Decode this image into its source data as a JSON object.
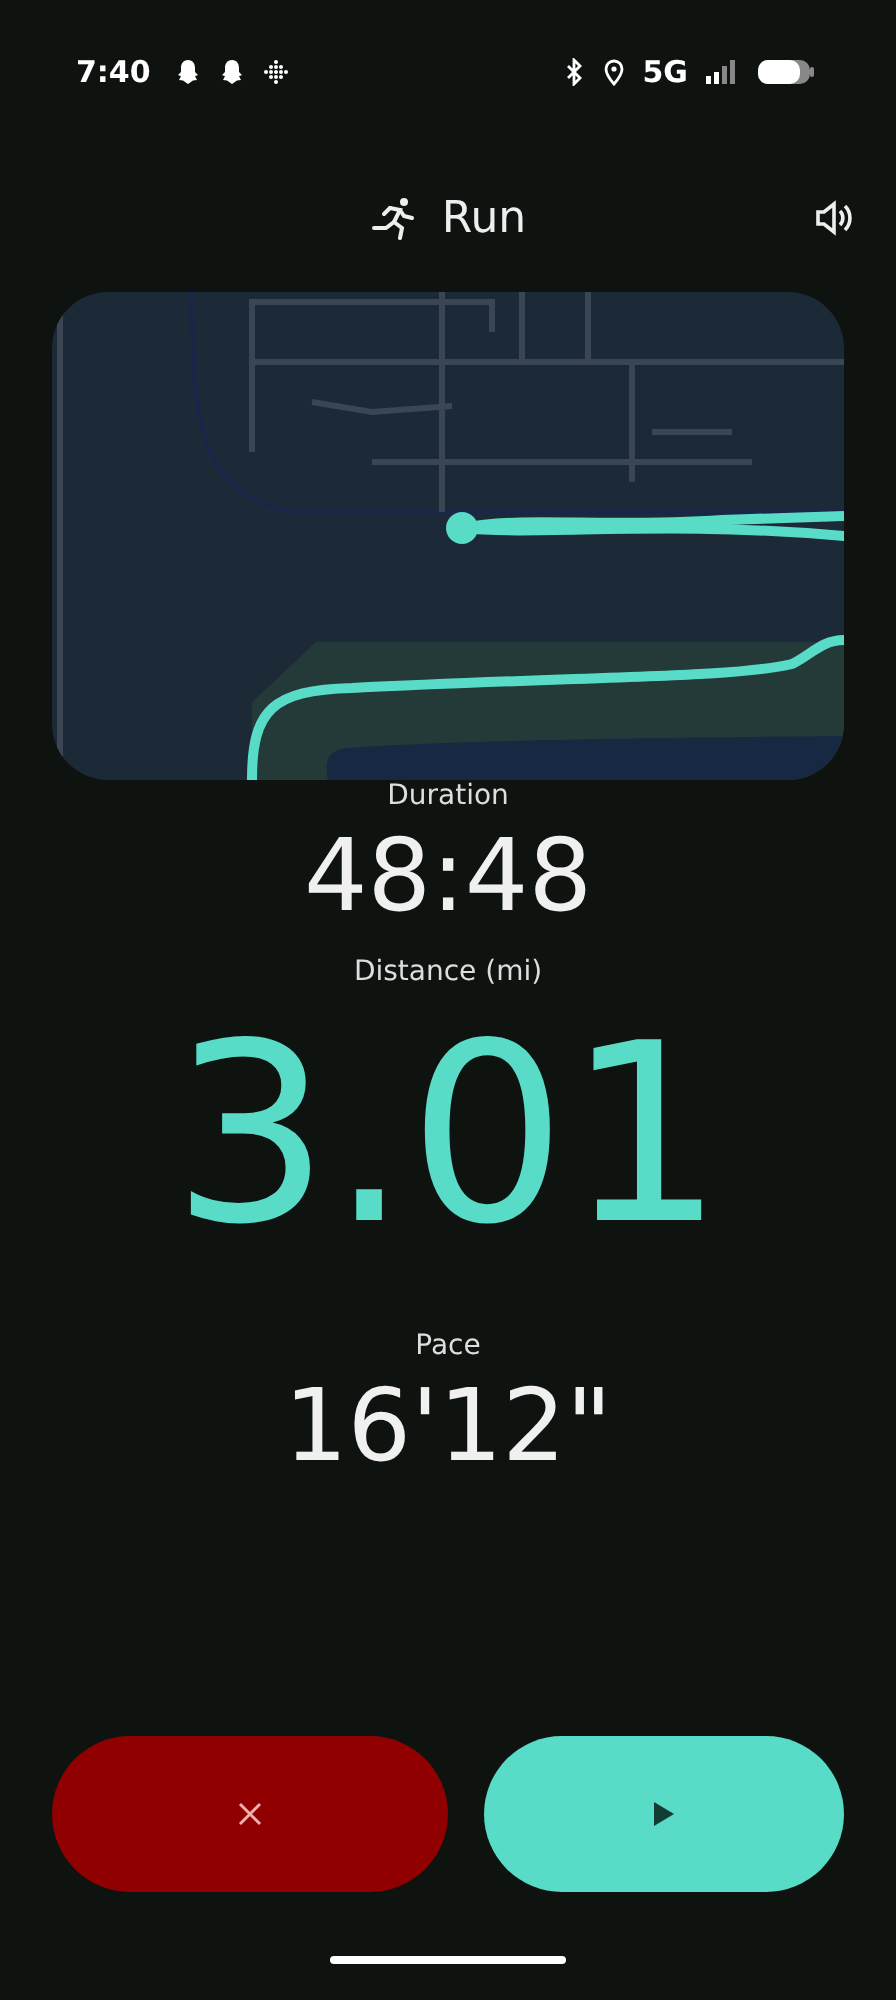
{
  "status_bar": {
    "time": "7:40",
    "network": "5G"
  },
  "header": {
    "title": "Run"
  },
  "stats": [
    {
      "label": "Duration",
      "value": "48:48",
      "kind": "normal"
    },
    {
      "label": "Distance (mi)",
      "value": "3.01",
      "kind": "highlight"
    },
    {
      "label": "Pace",
      "value": "16'12\"",
      "kind": "normal"
    }
  ],
  "buttons": [
    {
      "kind": "discard"
    },
    {
      "kind": "resume"
    }
  ]
}
